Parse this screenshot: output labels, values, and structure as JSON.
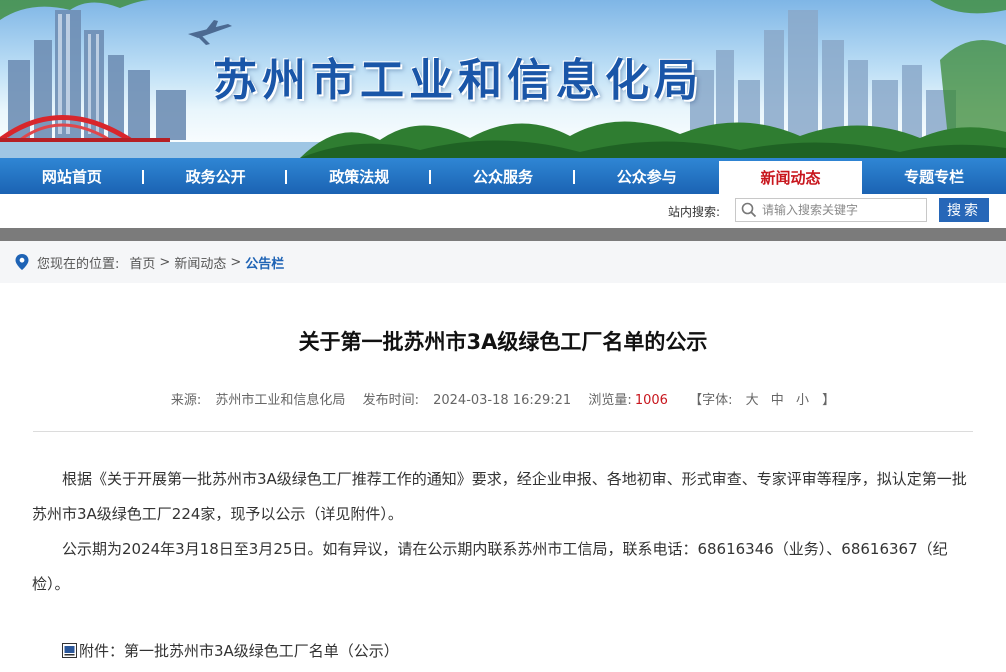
{
  "site": {
    "title": "苏州市工业和信息化局"
  },
  "nav": [
    {
      "label": "网站首页"
    },
    {
      "label": "政务公开"
    },
    {
      "label": "政策法规"
    },
    {
      "label": "公众服务"
    },
    {
      "label": "公众参与"
    },
    {
      "label": "新闻动态",
      "active": true
    },
    {
      "label": "专题专栏"
    }
  ],
  "search": {
    "label": "站内搜索:",
    "placeholder": "请输入搜索关键字",
    "button": "搜索"
  },
  "breadcrumb": {
    "prefix": "您现在的位置:",
    "home": "首页",
    "section": "新闻动态",
    "current": "公告栏",
    "sep": ">"
  },
  "article": {
    "title": "关于第一批苏州市3A级绿色工厂名单的公示",
    "meta": {
      "source_label": "来源:",
      "source": "苏州市工业和信息化局",
      "time_label": "发布时间:",
      "time": "2024-03-18 16:29:21",
      "views_label": "浏览量:",
      "views": "1006",
      "font_label": "【字体:",
      "font_large": "大",
      "font_medium": "中",
      "font_small": "小",
      "font_end": "】"
    },
    "paragraphs": [
      "根据《关于开展第一批苏州市3A级绿色工厂推荐工作的通知》要求，经企业申报、各地初审、形式审查、专家评审等程序，拟认定第一批苏州市3A级绿色工厂224家，现予以公示（详见附件）。",
      "公示期为2024年3月18日至3月25日。如有异议，请在公示期内联系苏州市工信局，联系电话：68616346（业务）、68616367（纪检）。"
    ],
    "attachment": "附件：第一批苏州市3A级绿色工厂名单（公示）"
  },
  "colors": {
    "nav_blue": "#1b63b3",
    "active_red": "#c8161d",
    "title_blue": "#1a56a8",
    "button_blue": "#2767b8"
  },
  "icons": {
    "location": "location-pin-icon",
    "search": "magnifier-icon",
    "attachment": "doc-icon",
    "plane": "airplane-icon"
  }
}
